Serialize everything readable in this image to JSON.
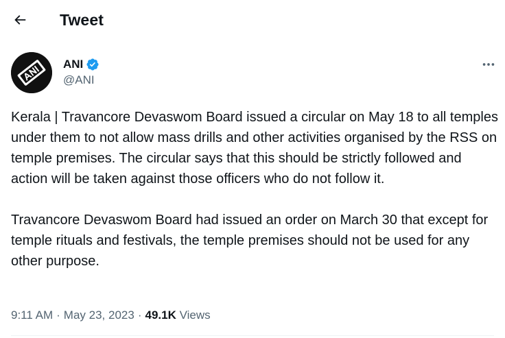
{
  "header": {
    "title": "Tweet",
    "back_icon": "arrow-left-icon"
  },
  "author": {
    "name": "ANI",
    "handle": "@ANI",
    "verified": true,
    "verified_color": "#1d9bf0",
    "avatar_text": "ANI"
  },
  "more_icon": "more-dots-icon",
  "tweet": {
    "paragraphs": [
      "Kerala | Travancore Devaswom Board issued a circular on May 18 to all temples under them to not allow mass drills and other activities organised by the RSS on temple premises. The circular says that this should be strictly followed and action will be taken against those officers who do not follow it.",
      "Travancore Devaswom Board had issued an order on March 30 that except for temple rituals and festivals, the temple premises should not be used for any other purpose."
    ]
  },
  "meta": {
    "time": "9:11 AM",
    "separator": "·",
    "date": "May 23, 2023",
    "views_count": "49.1K",
    "views_label": "Views"
  },
  "colors": {
    "text_primary": "#0f1419",
    "text_secondary": "#536471",
    "accent": "#1d9bf0",
    "divider": "#eff3f4"
  }
}
